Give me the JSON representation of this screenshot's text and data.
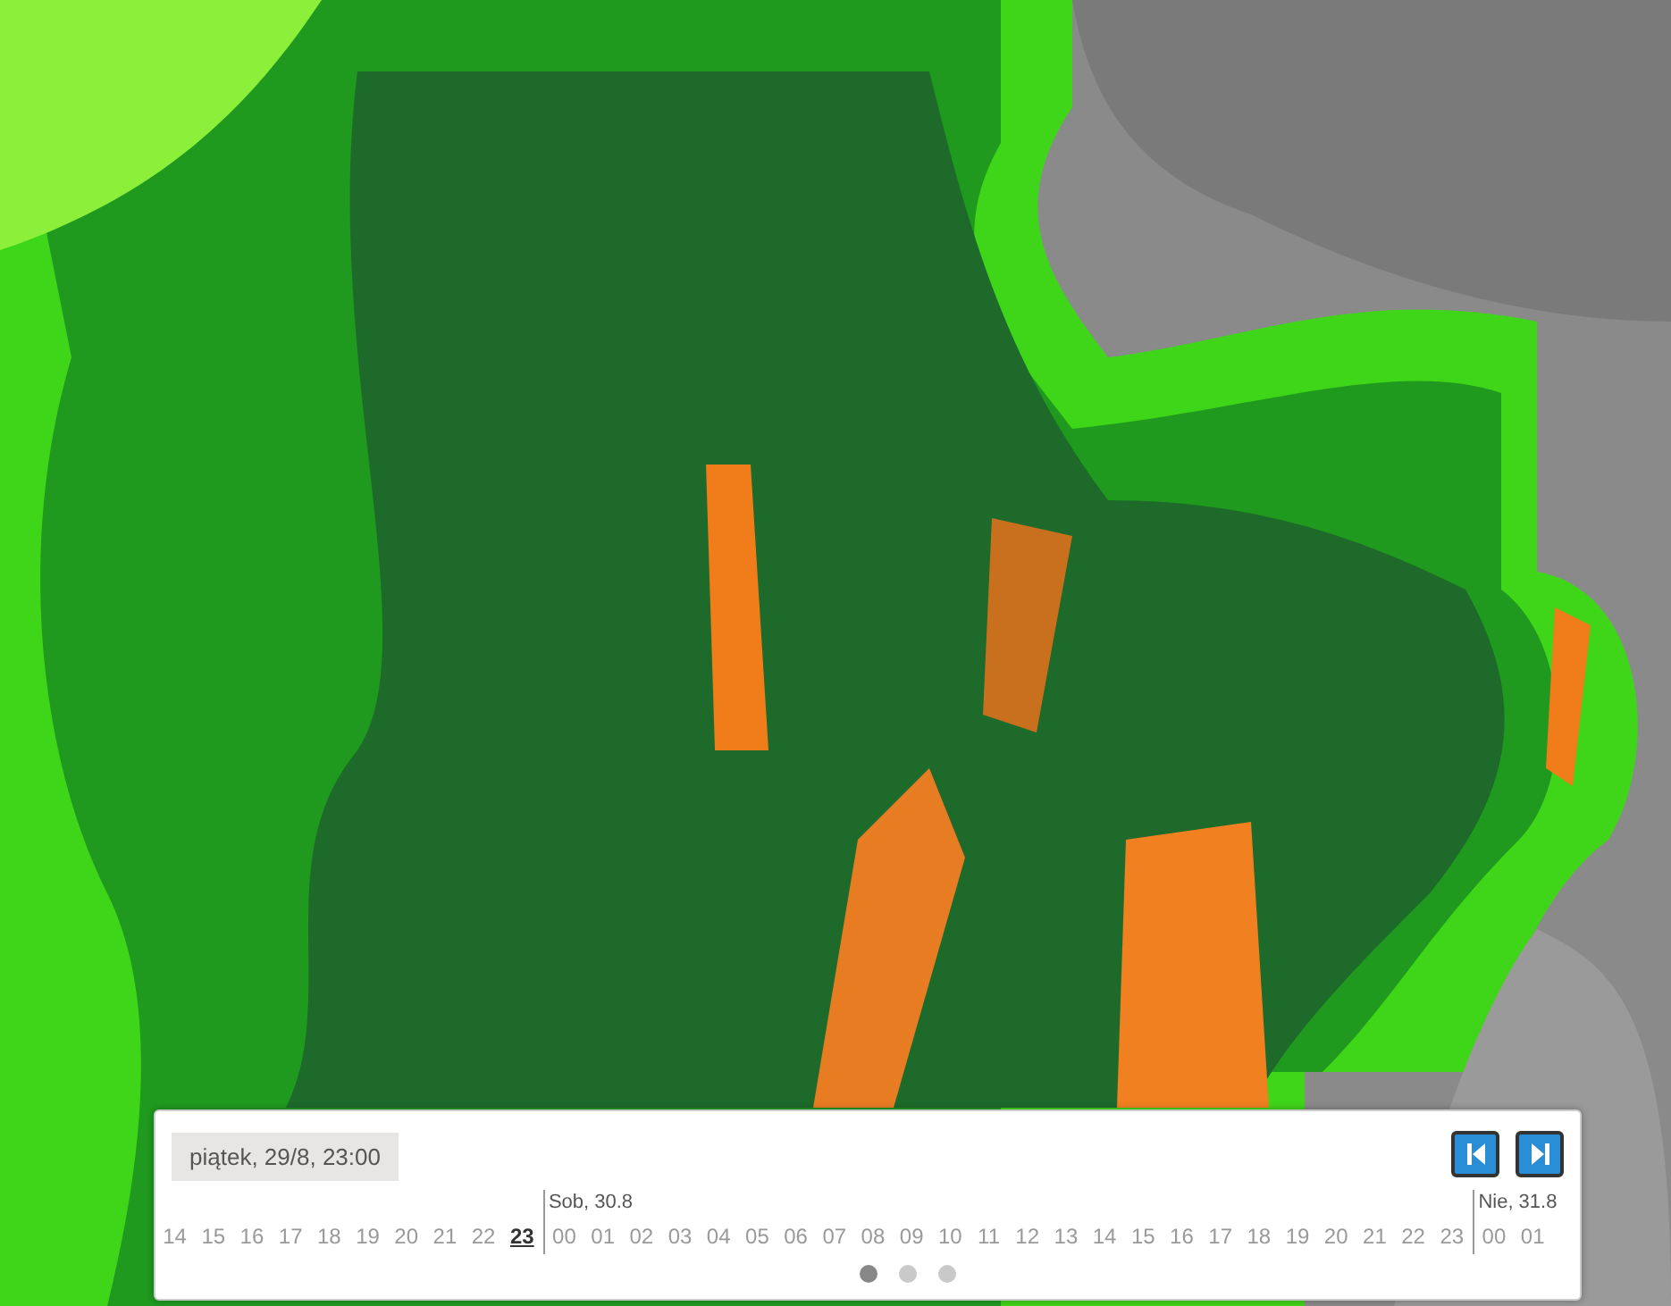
{
  "timeline": {
    "current": "piątek, 29/8, 23:00",
    "days": [
      {
        "hours": [
          {
            "text": "14",
            "selected": false
          },
          {
            "text": "15",
            "selected": false
          },
          {
            "text": "16",
            "selected": false
          },
          {
            "text": "17",
            "selected": false
          },
          {
            "text": "18",
            "selected": false
          },
          {
            "text": "19",
            "selected": false
          },
          {
            "text": "20",
            "selected": false
          },
          {
            "text": "21",
            "selected": false
          },
          {
            "text": "22",
            "selected": false
          },
          {
            "text": "23",
            "selected": true
          }
        ]
      },
      {
        "label": "Sob, 30.8",
        "hours": [
          {
            "text": "00",
            "selected": false
          },
          {
            "text": "01",
            "selected": false
          },
          {
            "text": "02",
            "selected": false
          },
          {
            "text": "03",
            "selected": false
          },
          {
            "text": "04",
            "selected": false
          },
          {
            "text": "05",
            "selected": false
          },
          {
            "text": "06",
            "selected": false
          },
          {
            "text": "07",
            "selected": false
          },
          {
            "text": "08",
            "selected": false
          },
          {
            "text": "09",
            "selected": false
          },
          {
            "text": "10",
            "selected": false
          },
          {
            "text": "11",
            "selected": false
          },
          {
            "text": "12",
            "selected": false
          },
          {
            "text": "13",
            "selected": false
          },
          {
            "text": "14",
            "selected": false
          },
          {
            "text": "15",
            "selected": false
          },
          {
            "text": "16",
            "selected": false
          },
          {
            "text": "17",
            "selected": false
          },
          {
            "text": "18",
            "selected": false
          },
          {
            "text": "19",
            "selected": false
          },
          {
            "text": "20",
            "selected": false
          },
          {
            "text": "21",
            "selected": false
          },
          {
            "text": "22",
            "selected": false
          },
          {
            "text": "23",
            "selected": false
          }
        ]
      },
      {
        "label": "Nie, 31.8",
        "hours": [
          {
            "text": "00",
            "selected": false
          },
          {
            "text": "01",
            "selected": false
          }
        ]
      }
    ],
    "pages": [
      {
        "selected": true
      },
      {
        "selected": false
      },
      {
        "selected": false
      }
    ]
  }
}
